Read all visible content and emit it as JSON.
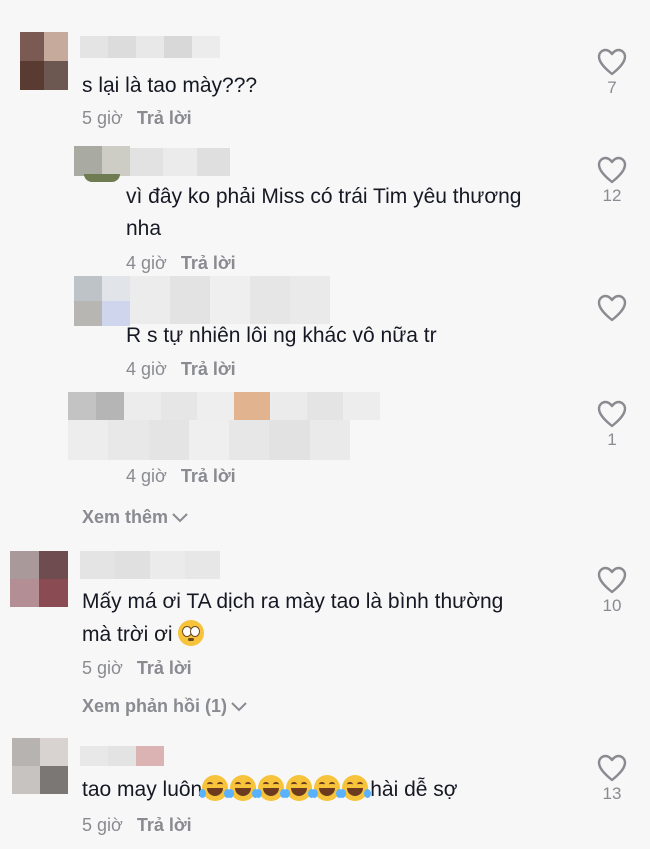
{
  "comments": [
    {
      "text": "s lại là tao mày???",
      "time": "5 giờ",
      "reply": "Trả lời",
      "likes": "7"
    },
    {
      "text_lines": [
        "vì đây ko phải Miss có trái Tim yêu thương",
        "nha"
      ],
      "time": "4 giờ",
      "reply": "Trả lời",
      "likes": "12"
    },
    {
      "text": "R s tự nhiên lôi ng khác vô nữa tr",
      "time": "4 giờ",
      "reply": "Trả lời",
      "likes": ""
    },
    {
      "time": "4 giờ",
      "reply": "Trả lời",
      "likes": "1"
    },
    {
      "text_lines": [
        "Mấy má ơi TA dịch ra mày tao là bình thường",
        "mà trời ơi"
      ],
      "time": "5 giờ",
      "reply": "Trả lời",
      "likes": "10"
    },
    {
      "text_before": "tao may luôn",
      "text_after": "hài dễ sợ",
      "time": "5 giờ",
      "reply": "Trả lời",
      "likes": "13"
    }
  ],
  "view_more_label": "Xem thêm",
  "view_replies_label": "Xem phản hồi (1)",
  "icons": {
    "like": "heart-outline-icon",
    "chevron": "chevron-down-icon",
    "flushed": "flushed-face-emoji",
    "laughing": "face-with-tears-of-joy-emoji"
  },
  "colors": {
    "background": "#f7f7f7",
    "text": "#161823",
    "muted": "#8a8b91"
  }
}
